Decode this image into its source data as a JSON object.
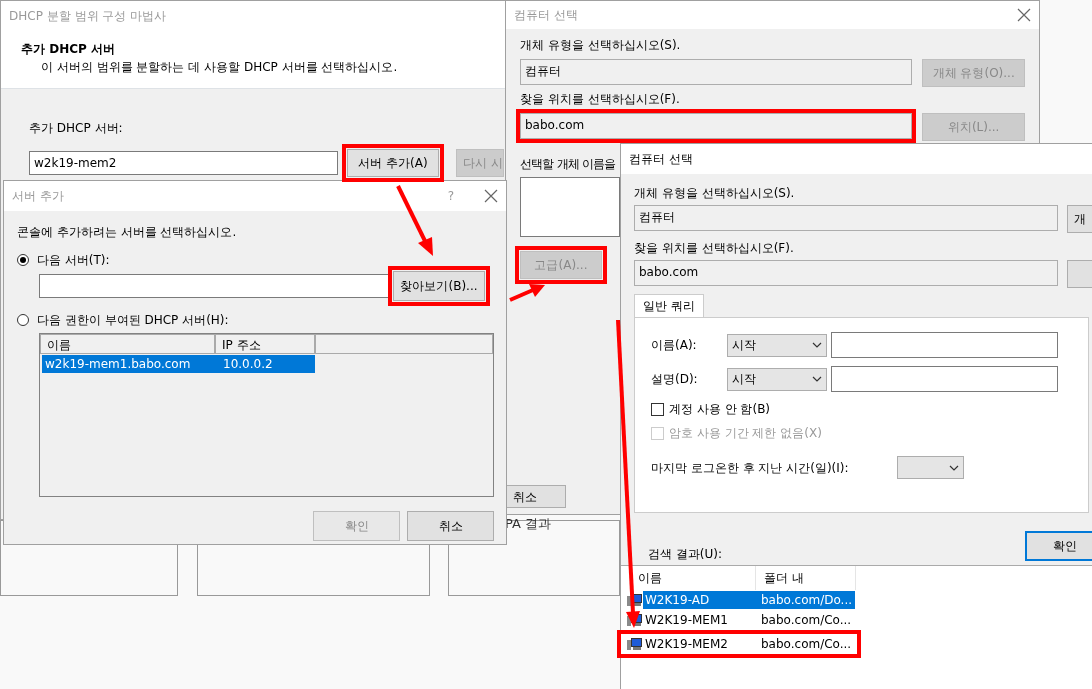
{
  "wizard": {
    "title": "DHCP 분할 범위 구성 마법사",
    "heading": "추가 DHCP 서버",
    "description": "이 서버의 범위를 분할하는 데 사용할 DHCP 서버를 선택하십시오.",
    "server_label": "추가 DHCP 서버:",
    "server_value": "w2k19-mem2",
    "buttons": [
      "서버 추가(A)",
      "다시 시"
    ]
  },
  "background": {
    "text": "PA 결과"
  },
  "computer_select_back": {
    "title": "컴퓨터 선택",
    "object_type_label": "개체 유형을 선택하십시오(S).",
    "object_type_value": "컴퓨터",
    "object_type_button": "개체 유형(O)...",
    "location_label": "찾을 위치를 선택하십시오(F).",
    "location_value": "babo.com",
    "location_button": "위치(L)...",
    "names_label": "선택할 개체 이름을",
    "advanced_button": "고급(A)...",
    "cancel_button": "취소"
  },
  "add_server_dialog": {
    "title": "서버 추가",
    "help": "?",
    "prompt": "콘솔에 추가하려는 서버를 선택하십시오.",
    "options": [
      {
        "label": "다음 서버(T):",
        "selected": true
      },
      {
        "label": "다음 권한이 부여된 DHCP 서버(H):",
        "selected": false
      }
    ],
    "browse_button": "찾아보기(B)...",
    "columns": [
      "이름",
      "IP 주소"
    ],
    "rows": [
      {
        "name": "w2k19-mem1.babo.com",
        "ip": "10.0.0.2",
        "selected": true
      }
    ],
    "buttons": [
      {
        "label": "확인",
        "disabled": true
      },
      {
        "label": "취소",
        "disabled": false
      }
    ]
  },
  "computer_select_front": {
    "title": "컴퓨터 선택",
    "object_type_label": "개체 유형을 선택하십시오(S).",
    "object_type_value": "컴퓨터",
    "object_type_button": "개",
    "location_label": "찾을 위치를 선택하십시오(F).",
    "location_value": "babo.com",
    "tabs": [
      {
        "label": "일반 쿼리",
        "selected": true
      }
    ],
    "fields": [
      {
        "label": "이름(A):",
        "operator": "시작"
      },
      {
        "label": "설명(D):",
        "operator": "시작"
      }
    ],
    "checks": [
      {
        "label": "계정 사용 안 함(B)",
        "checked": false,
        "disabled": false
      },
      {
        "label": "암호 사용 기간 제한 없음(X)",
        "checked": false,
        "disabled": true
      }
    ],
    "days_label": "마지막 로그온한 후 지난 시간(일)(I):",
    "ok_button": "확인",
    "results_label": "검색 결과(U):",
    "result_columns": [
      "이름",
      "폴더 내"
    ],
    "results": [
      {
        "name": "W2K19-AD",
        "folder": "babo.com/Do...",
        "selected": true
      },
      {
        "name": "W2K19-MEM1",
        "folder": "babo.com/Co...",
        "selected": false
      },
      {
        "name": "W2K19-MEM2",
        "folder": "babo.com/Co...",
        "selected": false
      }
    ]
  }
}
